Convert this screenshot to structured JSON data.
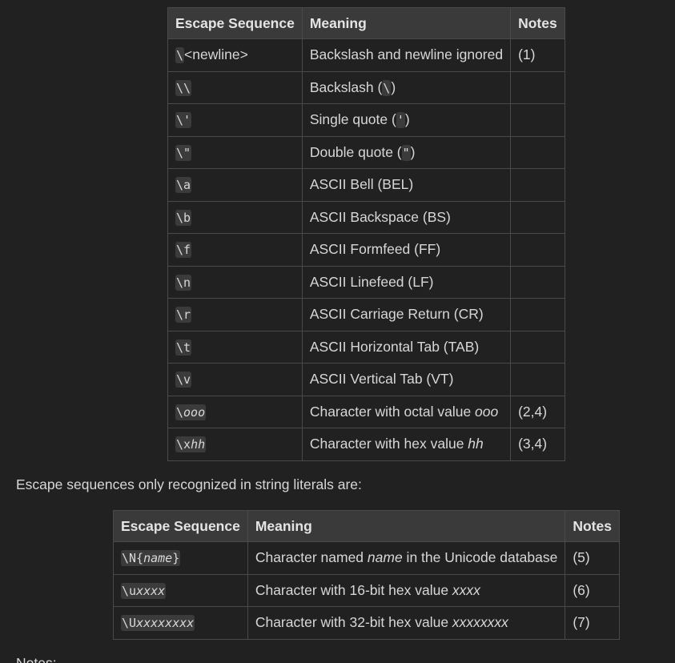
{
  "table1": {
    "headers": [
      "Escape Sequence",
      "Meaning",
      "Notes"
    ],
    "rows": [
      {
        "seq_code": "\\",
        "seq_plain": "<newline>",
        "seq_italic": "",
        "meaning_pre": "Backslash and newline ignored",
        "meaning_code": "",
        "meaning_italic": "",
        "meaning_post": "",
        "notes": "(1)"
      },
      {
        "seq_code": "\\\\",
        "seq_plain": "",
        "seq_italic": "",
        "meaning_pre": "Backslash (",
        "meaning_code": "\\",
        "meaning_italic": "",
        "meaning_post": ")",
        "notes": ""
      },
      {
        "seq_code": "\\'",
        "seq_plain": "",
        "seq_italic": "",
        "meaning_pre": "Single quote (",
        "meaning_code": "'",
        "meaning_italic": "",
        "meaning_post": ")",
        "notes": ""
      },
      {
        "seq_code": "\\\"",
        "seq_plain": "",
        "seq_italic": "",
        "meaning_pre": "Double quote (",
        "meaning_code": "\"",
        "meaning_italic": "",
        "meaning_post": ")",
        "notes": ""
      },
      {
        "seq_code": "\\a",
        "seq_plain": "",
        "seq_italic": "",
        "meaning_pre": "ASCII Bell (BEL)",
        "meaning_code": "",
        "meaning_italic": "",
        "meaning_post": "",
        "notes": ""
      },
      {
        "seq_code": "\\b",
        "seq_plain": "",
        "seq_italic": "",
        "meaning_pre": "ASCII Backspace (BS)",
        "meaning_code": "",
        "meaning_italic": "",
        "meaning_post": "",
        "notes": ""
      },
      {
        "seq_code": "\\f",
        "seq_plain": "",
        "seq_italic": "",
        "meaning_pre": "ASCII Formfeed (FF)",
        "meaning_code": "",
        "meaning_italic": "",
        "meaning_post": "",
        "notes": ""
      },
      {
        "seq_code": "\\n",
        "seq_plain": "",
        "seq_italic": "",
        "meaning_pre": "ASCII Linefeed (LF)",
        "meaning_code": "",
        "meaning_italic": "",
        "meaning_post": "",
        "notes": ""
      },
      {
        "seq_code": "\\r",
        "seq_plain": "",
        "seq_italic": "",
        "meaning_pre": "ASCII Carriage Return (CR)",
        "meaning_code": "",
        "meaning_italic": "",
        "meaning_post": "",
        "notes": ""
      },
      {
        "seq_code": "\\t",
        "seq_plain": "",
        "seq_italic": "",
        "meaning_pre": "ASCII Horizontal Tab (TAB)",
        "meaning_code": "",
        "meaning_italic": "",
        "meaning_post": "",
        "notes": ""
      },
      {
        "seq_code": "\\v",
        "seq_plain": "",
        "seq_italic": "",
        "meaning_pre": "ASCII Vertical Tab (VT)",
        "meaning_code": "",
        "meaning_italic": "",
        "meaning_post": "",
        "notes": ""
      },
      {
        "seq_code": "\\",
        "seq_plain": "",
        "seq_italic": "ooo",
        "meaning_pre": "Character with octal value ",
        "meaning_code": "",
        "meaning_italic": "ooo",
        "meaning_post": "",
        "notes": "(2,4)"
      },
      {
        "seq_code": "\\x",
        "seq_plain": "",
        "seq_italic": "hh",
        "meaning_pre": "Character with hex value ",
        "meaning_code": "",
        "meaning_italic": "hh",
        "meaning_post": "",
        "notes": "(3,4)"
      }
    ]
  },
  "paragraph": "Escape sequences only recognized in string literals are:",
  "table2": {
    "headers": [
      "Escape Sequence",
      "Meaning",
      "Notes"
    ],
    "rows": [
      {
        "seq_code": "\\N{",
        "seq_italic": "name",
        "seq_code_post": "}",
        "meaning_pre": "Character named ",
        "meaning_italic": "name",
        "meaning_post": " in the Unicode database",
        "notes": "(5)"
      },
      {
        "seq_code": "\\u",
        "seq_italic": "xxxx",
        "seq_code_post": "",
        "meaning_pre": "Character with 16-bit hex value ",
        "meaning_italic": "xxxx",
        "meaning_post": "",
        "notes": "(6)"
      },
      {
        "seq_code": "\\U",
        "seq_italic": "xxxxxxxx",
        "seq_code_post": "",
        "meaning_pre": "Character with 32-bit hex value ",
        "meaning_italic": "xxxxxxxx",
        "meaning_post": "",
        "notes": "(7)"
      }
    ]
  },
  "notes_heading": "Notes:"
}
